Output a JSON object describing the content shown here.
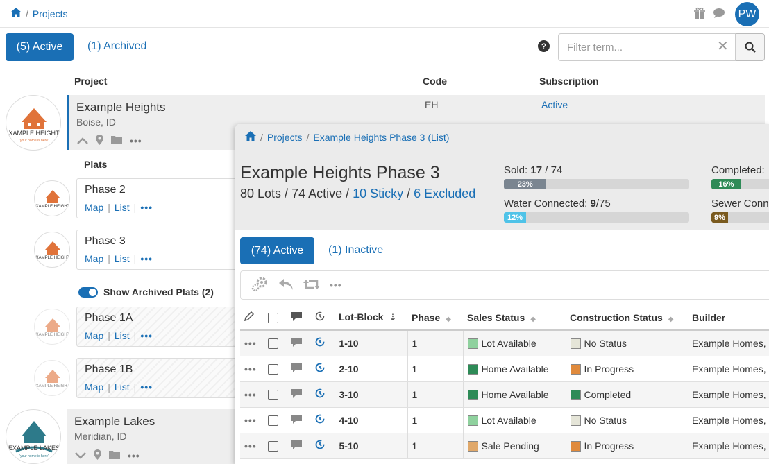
{
  "breadcrumb": {
    "home_icon": "home-icon",
    "current": "Projects"
  },
  "user": {
    "initials": "PW"
  },
  "top_icons": [
    "gift-icon",
    "chat-icon"
  ],
  "tabs": {
    "active": "(5) Active",
    "archived": "(1) Archived"
  },
  "filter": {
    "placeholder": "Filter term...",
    "value": ""
  },
  "columns": {
    "project": "Project",
    "code": "Code",
    "subscription": "Subscription"
  },
  "projects": [
    {
      "name": "Example Heights",
      "location": "Boise, ID",
      "code": "EH",
      "subscription": "Active",
      "logo_text": "XAMPLE HEIGHT",
      "logo_tag": "\"your home is here\""
    },
    {
      "name": "Example Lakes",
      "location": "Meridian, ID",
      "logo_text": "EXAMPLE LAKES",
      "logo_tag": "\"your home is here\""
    }
  ],
  "plats": {
    "label": "Plats",
    "map_label": "Map",
    "list_label": "List",
    "items": [
      {
        "name": "Phase 2",
        "archived": false
      },
      {
        "name": "Phase 3",
        "archived": false
      },
      {
        "name": "Phase 1A",
        "archived": true
      },
      {
        "name": "Phase 1B",
        "archived": true
      }
    ],
    "show_archived_label": "Show Archived Plats (2)"
  },
  "panel": {
    "breadcrumb": [
      "Projects",
      "Example Heights Phase 3 (List)"
    ],
    "title": "Example Heights Phase 3",
    "summary": {
      "lots": "80 Lots",
      "active": "74 Active",
      "sticky": "10 Sticky",
      "excluded": "6 Excluded"
    },
    "stats": {
      "sold": {
        "label": "Sold:",
        "value": "17",
        "total": "74",
        "percent": "23%",
        "fraction": 0.23,
        "color": "#7a8590"
      },
      "water": {
        "label": "Water Connected:",
        "value": "9",
        "total": "75",
        "percent": "12%",
        "fraction": 0.12,
        "color": "#4fc3e8"
      },
      "completed": {
        "label": "Completed:",
        "percent": "16%",
        "fraction": 0.16,
        "color": "#2e8b57"
      },
      "sewer": {
        "label": "Sewer Conn",
        "percent": "9%",
        "fraction": 0.09,
        "color": "#7a5a1e"
      }
    },
    "tabs": {
      "active": "(74) Active",
      "inactive": "(1) Inactive"
    },
    "table": {
      "headers": {
        "lot_block": "Lot-Block",
        "phase": "Phase",
        "sales_status": "Sales Status",
        "construction_status": "Construction Status",
        "builder": "Builder"
      },
      "rows": [
        {
          "lot": "1-10",
          "phase": "1",
          "sales": "Lot Available",
          "sales_color": "#8fd19e",
          "construction": "No Status",
          "construction_color": "#e5e5d8",
          "builder": "Example Homes,"
        },
        {
          "lot": "2-10",
          "phase": "1",
          "sales": "Home Available",
          "sales_color": "#2e8b57",
          "construction": "In Progress",
          "construction_color": "#e08a3c",
          "builder": "Example Homes,"
        },
        {
          "lot": "3-10",
          "phase": "1",
          "sales": "Home Available",
          "sales_color": "#2e8b57",
          "construction": "Completed",
          "construction_color": "#2e8b57",
          "builder": "Example Homes,"
        },
        {
          "lot": "4-10",
          "phase": "1",
          "sales": "Lot Available",
          "sales_color": "#8fd19e",
          "construction": "No Status",
          "construction_color": "#e5e5d8",
          "builder": "Example Homes,"
        },
        {
          "lot": "5-10",
          "phase": "1",
          "sales": "Sale Pending",
          "sales_color": "#e0a86a",
          "construction": "In Progress",
          "construction_color": "#e08a3c",
          "builder": "Example Homes,"
        }
      ]
    }
  },
  "colors": {
    "accent": "#1a6fb5",
    "logo_orange": "#e0733a",
    "logo_teal": "#2d7a8a"
  }
}
